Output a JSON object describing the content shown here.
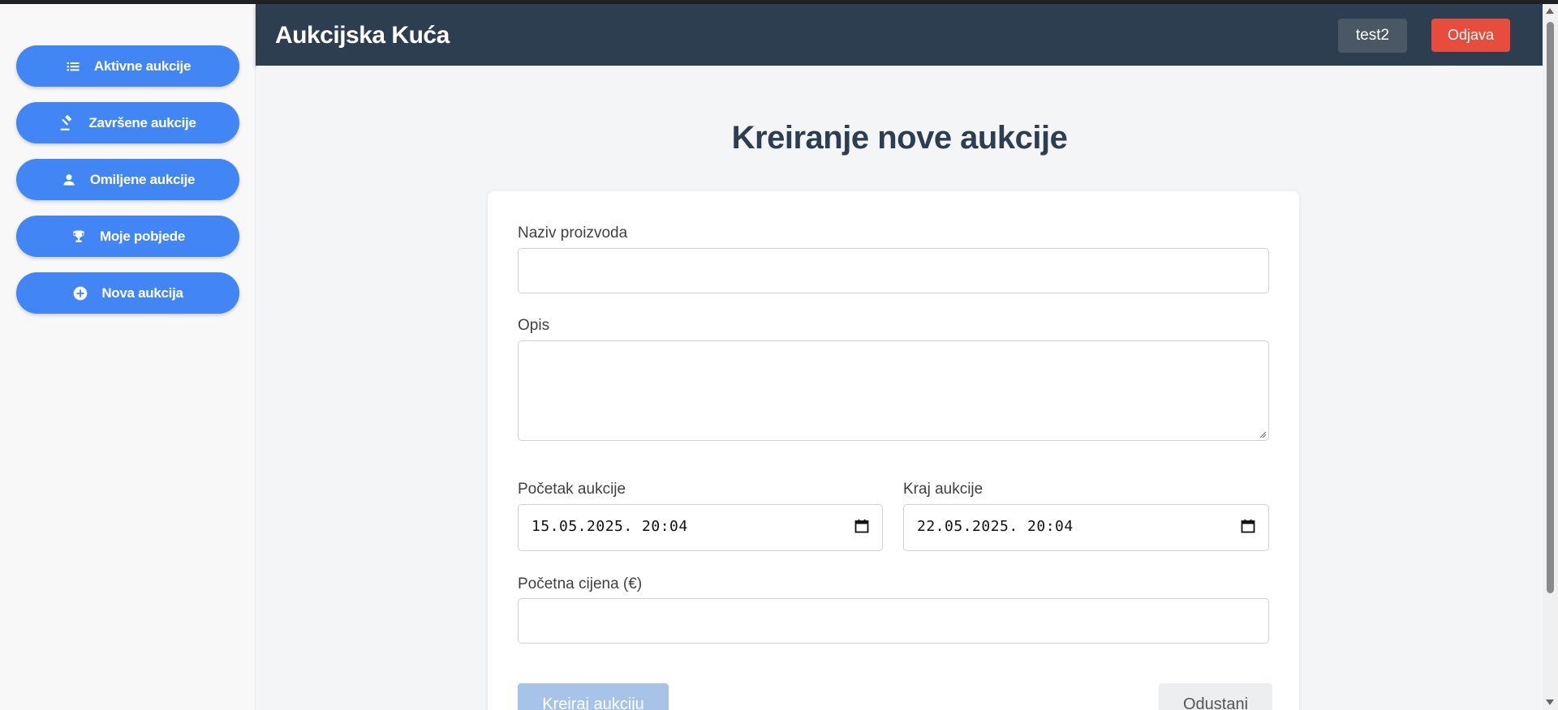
{
  "sidebar": {
    "items": [
      {
        "label": "Aktivne aukcije",
        "icon": "list-icon"
      },
      {
        "label": "Završene aukcije",
        "icon": "gavel-icon"
      },
      {
        "label": "Omiljene aukcije",
        "icon": "person-icon"
      },
      {
        "label": "Moje pobjede",
        "icon": "trophy-icon"
      },
      {
        "label": "Nova aukcija",
        "icon": "plus-circle-icon"
      }
    ]
  },
  "header": {
    "brand": "Aukcijska Kuća",
    "username": "test2",
    "logout_label": "Odjava"
  },
  "main": {
    "title": "Kreiranje nove aukcije",
    "form": {
      "name_label": "Naziv proizvoda",
      "name_value": "",
      "description_label": "Opis",
      "description_value": "",
      "start_label": "Početak aukcije",
      "start_value": "15.05.2025. 20:04",
      "end_label": "Kraj aukcije",
      "end_value": "22.05.2025. 20:04",
      "price_label": "Početna cijena (€)",
      "price_value": "",
      "create_label": "Kreiraj aukciju",
      "cancel_label": "Odustani"
    }
  },
  "colors": {
    "primary": "#4285f4",
    "header_bg": "#2c3e50",
    "danger": "#e74c3c",
    "disabled_primary": "#a8c3e8"
  }
}
